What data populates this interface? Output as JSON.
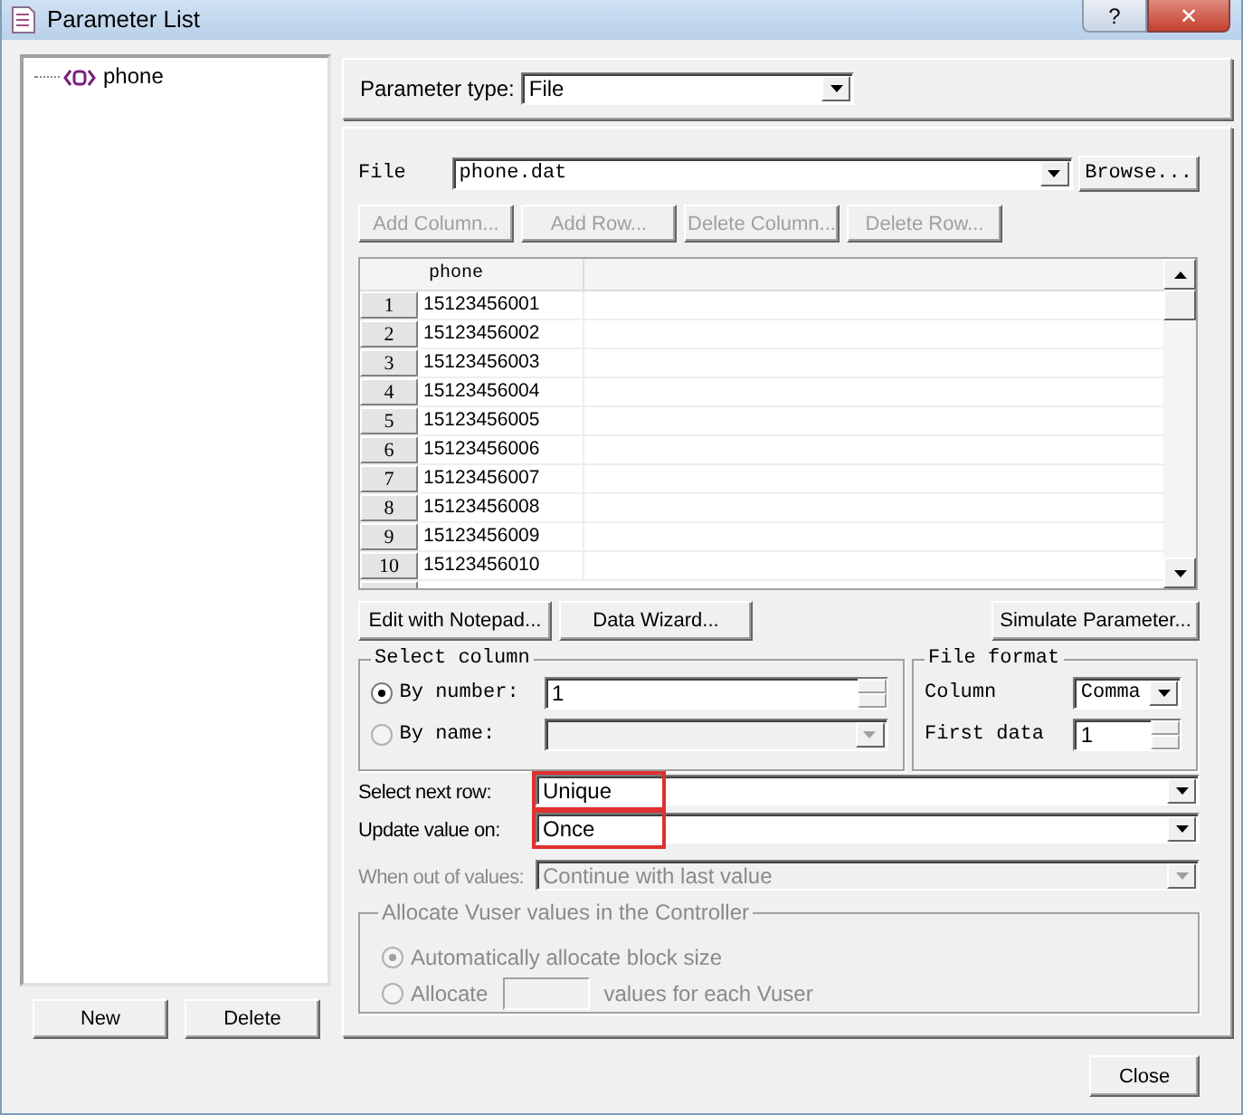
{
  "window": {
    "title": "Parameter List",
    "help_button": "?",
    "close_button": "✕"
  },
  "parameter_tree": [
    {
      "label": "phone",
      "selected": false
    }
  ],
  "list_buttons": [
    {
      "label": "New"
    },
    {
      "label": "Delete"
    }
  ],
  "parameter_type": {
    "label": "Parameter type:",
    "value": "File"
  },
  "file": {
    "label": "File",
    "value": "phone.dat",
    "browse": "Browse..."
  },
  "table_buttons": [
    {
      "label": "Add Column...",
      "disabled": true
    },
    {
      "label": "Add Row...",
      "disabled": true
    },
    {
      "label": "Delete Column...",
      "disabled": true
    },
    {
      "label": "Delete Row...",
      "disabled": true
    }
  ],
  "table": {
    "columns": [
      "phone"
    ],
    "rows": [
      {
        "number": "1",
        "cells": [
          "15123456001"
        ]
      },
      {
        "number": "2",
        "cells": [
          "15123456002"
        ]
      },
      {
        "number": "3",
        "cells": [
          "15123456003"
        ]
      },
      {
        "number": "4",
        "cells": [
          "15123456004"
        ]
      },
      {
        "number": "5",
        "cells": [
          "15123456005"
        ]
      },
      {
        "number": "6",
        "cells": [
          "15123456006"
        ]
      },
      {
        "number": "7",
        "cells": [
          "15123456007"
        ]
      },
      {
        "number": "8",
        "cells": [
          "15123456008"
        ]
      },
      {
        "number": "9",
        "cells": [
          "15123456009"
        ]
      },
      {
        "number": "10",
        "cells": [
          "15123456010"
        ]
      }
    ]
  },
  "data_buttons": [
    {
      "label": "Edit with Notepad..."
    },
    {
      "label": "Data Wizard..."
    },
    {
      "label": "Simulate Parameter..."
    }
  ],
  "select_column": {
    "title": "Select column",
    "options": [
      {
        "label": "By number:",
        "selected": true,
        "disabled": false,
        "value": "1"
      },
      {
        "label": "By name:",
        "selected": false,
        "disabled": true
      }
    ]
  },
  "file_format": {
    "title": "File format",
    "column": {
      "label": "Column",
      "value": "Comma"
    },
    "first_data": {
      "label": "First data",
      "value": "1"
    }
  },
  "settings": [
    {
      "label": "Select next row:",
      "value": "Unique",
      "disabled": false,
      "highlighted": true
    },
    {
      "label": "Update value on:",
      "value": "Once",
      "disabled": false,
      "highlighted": true
    },
    {
      "label": "When out of values:",
      "value": "Continue with last value",
      "disabled": true,
      "highlighted": false
    }
  ],
  "allocate": {
    "title": "Allocate Vuser values in the Controller",
    "disabled": true,
    "options": [
      {
        "kind": "auto",
        "label": "Automatically allocate block size",
        "selected": true
      },
      {
        "kind": "count",
        "label": "Allocate",
        "suffix": "values for each Vuser",
        "selected": false
      }
    ]
  },
  "close_button": "Close"
}
